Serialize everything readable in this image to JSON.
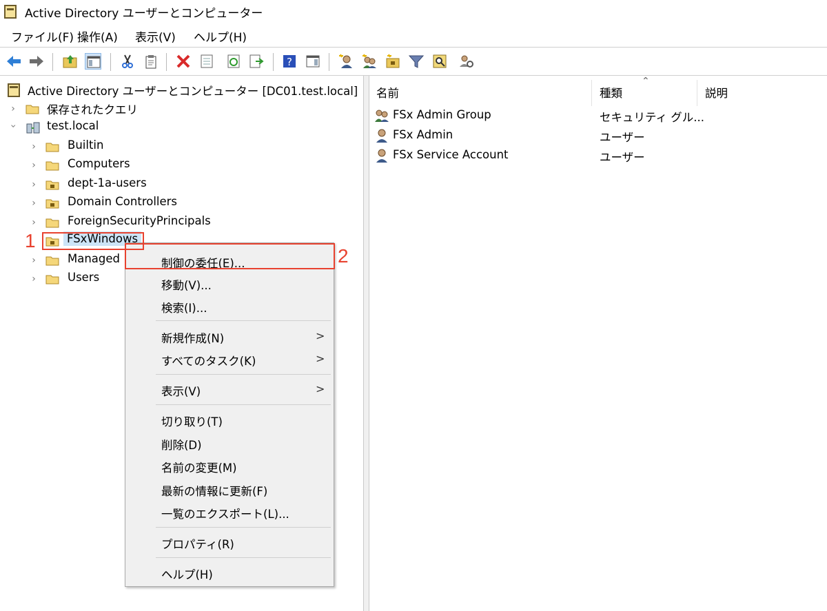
{
  "window": {
    "title": "Active Directory ユーザーとコンピューター"
  },
  "menubar": {
    "items": [
      "ファイル(F)",
      "操作(A)",
      "表示(V)",
      "ヘルプ(H)"
    ]
  },
  "toolbar": {
    "icons": [
      "back-arrow-icon",
      "forward-arrow-icon",
      "up-folder-icon",
      "show-hide-tree-icon",
      "cut-icon",
      "copy-icon",
      "delete-icon",
      "properties-icon",
      "refresh-icon",
      "export-list-icon",
      "help-icon",
      "action-pane-icon",
      "new-user-icon",
      "new-group-icon",
      "new-ou-icon",
      "filter-icon",
      "find-icon",
      "delegate-icon"
    ]
  },
  "tree": {
    "root": "Active Directory ユーザーとコンピューター [DC01.test.local]",
    "saved_queries": "保存されたクエリ",
    "domain": "test.local",
    "children": [
      "Builtin",
      "Computers",
      "dept-1a-users",
      "Domain Controllers",
      "ForeignSecurityPrincipals",
      "FSxWindows",
      "Managed",
      "Users"
    ]
  },
  "list": {
    "columns": [
      "名前",
      "種類",
      "説明"
    ],
    "rows": [
      {
        "name": "FSx Admin Group",
        "type": "セキュリティ グル...",
        "icon": "group-icon"
      },
      {
        "name": "FSx Admin",
        "type": "ユーザー",
        "icon": "user-icon"
      },
      {
        "name": "FSx Service Account",
        "type": "ユーザー",
        "icon": "user-icon"
      }
    ]
  },
  "context_menu": {
    "items": [
      {
        "label": "制御の委任(E)..."
      },
      {
        "label": "移動(V)..."
      },
      {
        "label": "検索(I)..."
      },
      {
        "label": "新規作成(N)",
        "submenu": true
      },
      {
        "label": "すべてのタスク(K)",
        "submenu": true
      },
      {
        "label": "表示(V)",
        "submenu": true
      },
      {
        "label": "切り取り(T)"
      },
      {
        "label": "削除(D)"
      },
      {
        "label": "名前の変更(M)"
      },
      {
        "label": "最新の情報に更新(F)"
      },
      {
        "label": "一覧のエクスポート(L)..."
      },
      {
        "label": "プロパティ(R)"
      },
      {
        "label": "ヘルプ(H)"
      }
    ],
    "submenu_glyph": ">"
  },
  "annotations": {
    "step1": "1",
    "step2": "2",
    "color": "#e8422f"
  }
}
